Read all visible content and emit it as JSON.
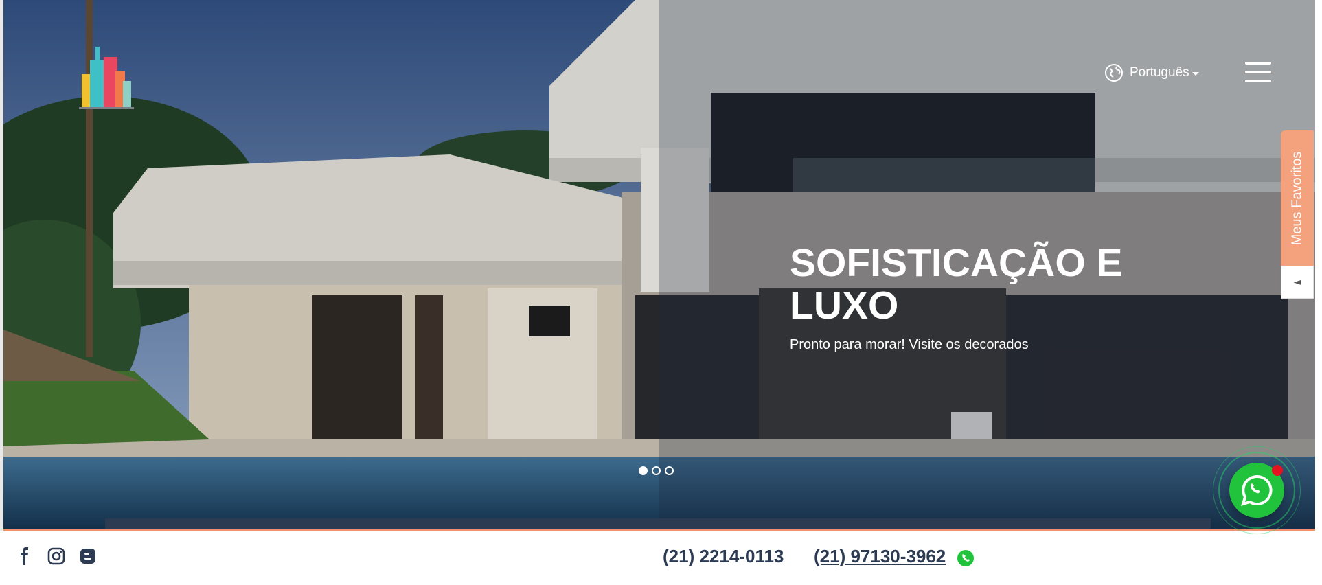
{
  "header": {
    "language_label": "Português",
    "icons": {
      "language": "globe-icon",
      "menu": "hamburger-menu-icon",
      "logo": "city-skyline-logo"
    }
  },
  "hero": {
    "title": "SOFISTICAÇÃO E LUXO",
    "subtitle": "Pronto para morar! Visite os decorados",
    "slides_total": 3,
    "active_slide": 1
  },
  "favorites": {
    "label": "Meus Favoritos",
    "toggle_icon": "◄"
  },
  "footer": {
    "phone_landline": "(21) 2214-0113",
    "phone_whatsapp": "(21) 97130-3962",
    "social_icons": [
      "facebook-icon",
      "instagram-icon",
      "blogger-icon"
    ]
  },
  "colors": {
    "navy": "#2c3a52",
    "accent_orange": "#f4a27d",
    "whatsapp_green": "#22c33c",
    "badge_red": "#e5121f"
  }
}
